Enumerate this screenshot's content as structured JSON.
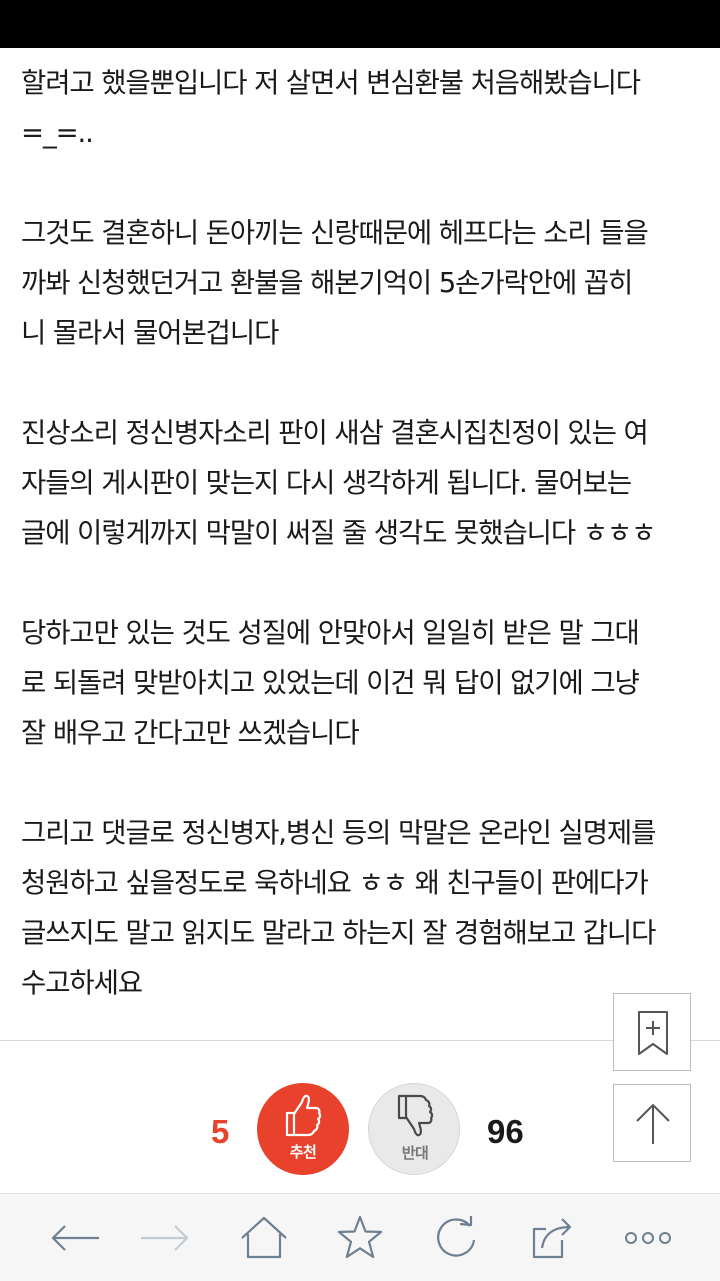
{
  "article": {
    "paragraphs": [
      [
        "할려고 했을뿐입니다 저 살면서 변심환불 처음해봤습니다",
        "=_=.."
      ],
      [
        "그것도 결혼하니 돈아끼는 신랑때문에 헤프다는 소리 들을",
        "까봐 신청했던거고 환불을 해본기억이 5손가락안에 꼽히",
        "니 몰라서 물어본겁니다"
      ],
      [
        "진상소리 정신병자소리 판이 새삼 결혼시집친정이 있는 여",
        "자들의 게시판이 맞는지 다시 생각하게 됩니다. 물어보는",
        "글에 이렇게까지 막말이 써질 줄 생각도 못했습니다 ㅎㅎㅎ"
      ],
      [
        "당하고만 있는 것도 성질에 안맞아서 일일히 받은 말 그대",
        "로 되돌려 맞받아치고 있었는데 이건 뭐 답이 없기에 그냥",
        "잘 배우고 간다고만 쓰겠습니다"
      ],
      [
        "그리고 댓글로 정신병자,병신 등의 막말은 온라인 실명제를",
        "청원하고 싶을정도로 욱하네요 ㅎㅎ 왜 친구들이 판에다가",
        "글쓰지도 말고 읽지도 말라고 하는지 잘 경험해보고 갑니다",
        "수고하세요"
      ]
    ]
  },
  "votes": {
    "recommend_count": "5",
    "recommend_label": "추천",
    "oppose_count": "96",
    "oppose_label": "반대"
  },
  "side_buttons": {
    "bookmark_icon": "bookmark-plus-icon",
    "top_icon": "arrow-up-icon"
  },
  "toolbar": {
    "icons": [
      "arrow-left-icon",
      "arrow-right-icon",
      "home-icon",
      "star-icon",
      "refresh-icon",
      "share-icon",
      "more-icon"
    ]
  },
  "colors": {
    "recommend_red": "#e8412c",
    "oppose_gray": "#e9e9e9",
    "toolbar_gray": "#6f7f92",
    "count_dark": "#1a1a1a"
  }
}
